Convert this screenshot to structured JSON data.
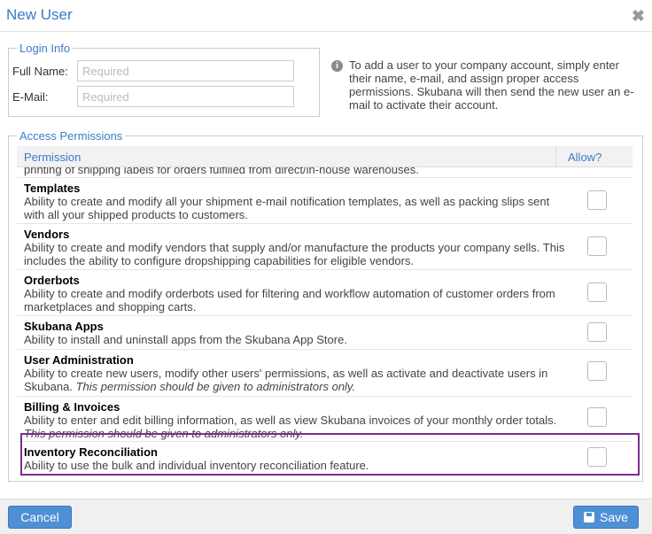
{
  "dialog": {
    "title": "New User",
    "close_glyph": "✖"
  },
  "login": {
    "legend": "Login Info",
    "full_name_label": "Full Name:",
    "full_name_placeholder": "Required",
    "email_label": "E-Mail:",
    "email_placeholder": "Required"
  },
  "info": {
    "icon_glyph": "i",
    "text": "To add a user to your company account, simply enter their name, e-mail, and assign proper access permissions. Skubana will then send the new user an e-mail to activate their account."
  },
  "access": {
    "legend": "Access Permissions",
    "col_permission": "Permission",
    "col_allow": "Allow?",
    "cutoff_text": "printing of shipping labels for orders fulfilled from direct/in-house warehouses.",
    "rows": [
      {
        "name": "Templates",
        "desc": "Ability to create and modify all your shipment e-mail notification templates, as well as packing slips sent with all your shipped products to customers.",
        "note": "",
        "allowed": false
      },
      {
        "name": "Vendors",
        "desc": "Ability to create and modify vendors that supply and/or manufacture the products your company sells. This includes the ability to configure dropshipping capabilities for eligible vendors.",
        "note": "",
        "allowed": false
      },
      {
        "name": "Orderbots",
        "desc": "Ability to create and modify orderbots used for filtering and workflow automation of customer orders from marketplaces and shopping carts.",
        "note": "",
        "allowed": false
      },
      {
        "name": "Skubana Apps",
        "desc": "Ability to install and uninstall apps from the Skubana App Store.",
        "note": "",
        "allowed": false
      },
      {
        "name": "User Administration",
        "desc": "Ability to create new users, modify other users' permissions, as well as activate and deactivate users in Skubana.",
        "note": "This permission should be given to administrators only.",
        "allowed": false
      },
      {
        "name": "Billing & Invoices",
        "desc": "Ability to enter and edit billing information, as well as view Skubana invoices of your monthly order totals.",
        "note": "This permission should be given to administrators only.",
        "allowed": false
      },
      {
        "name": "Inventory Reconciliation",
        "desc": "Ability to use the bulk and individual inventory reconciliation feature.",
        "note": "",
        "allowed": false
      }
    ]
  },
  "footer": {
    "cancel_label": "Cancel",
    "save_label": "Save"
  },
  "colors": {
    "accent": "#3a7cc7",
    "button": "#4f8fd6",
    "highlight": "#7b2d8e"
  }
}
